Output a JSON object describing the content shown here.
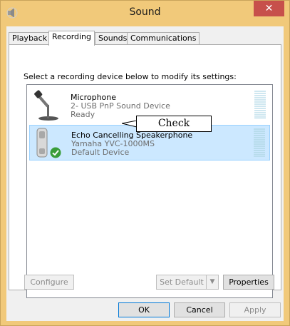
{
  "window": {
    "title": "Sound",
    "close_glyph": "✕",
    "app_icon": "speaker-icon"
  },
  "tabs": [
    {
      "label": "Playback",
      "active": false
    },
    {
      "label": "Recording",
      "active": true
    },
    {
      "label": "Sounds",
      "active": false
    },
    {
      "label": "Communications",
      "active": false
    }
  ],
  "instruction": "Select a recording device below to modify its settings:",
  "devices": [
    {
      "name": "Microphone",
      "description": "2- USB PnP Sound Device",
      "status": "Ready",
      "icon": "microphone-icon",
      "selected": false
    },
    {
      "name": "Echo Cancelling Speakerphone",
      "description": "Yamaha YVC-1000MS",
      "status": "Default Device",
      "icon": "phone-handset-icon",
      "badge": "green-check-icon",
      "selected": true
    }
  ],
  "callout": {
    "text": "Check"
  },
  "buttons": {
    "configure": "Configure",
    "set_default": "Set Default",
    "properties": "Properties",
    "ok": "OK",
    "cancel": "Cancel",
    "apply": "Apply"
  },
  "colors": {
    "frame": "#f1c97a",
    "close": "#c7504b",
    "selection": "#cce8ff",
    "check": "#3a9d3a"
  }
}
